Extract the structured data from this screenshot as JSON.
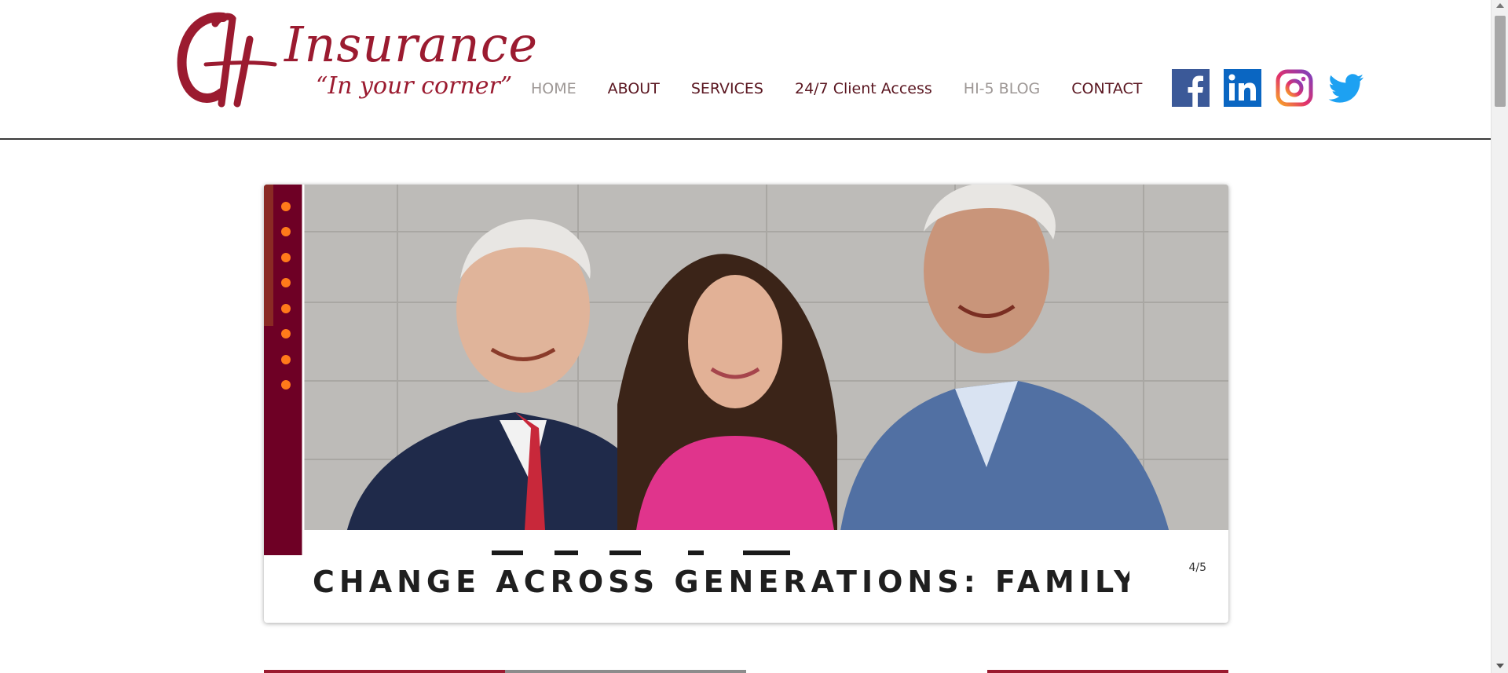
{
  "brand": {
    "monogram": "CH",
    "name": "Insurance",
    "tagline": "“In your corner”",
    "color": "#9b1b30"
  },
  "nav": {
    "items": [
      {
        "label": "HOME",
        "muted": true
      },
      {
        "label": "ABOUT",
        "muted": false
      },
      {
        "label": "SERVICES",
        "muted": false
      },
      {
        "label": "24/7 Client Access",
        "muted": false
      },
      {
        "label": "HI-5 BLOG",
        "muted": true
      },
      {
        "label": "CONTACT",
        "muted": false
      }
    ]
  },
  "social": [
    "facebook-icon",
    "linkedin-icon",
    "instagram-icon",
    "twitter-icon"
  ],
  "slideshow": {
    "caption": "CHANGE ACROSS GENERATIONS: FAMILY-O…",
    "counter": "4/5"
  },
  "colors": {
    "nav_text": "#5a1620",
    "nav_muted": "#9d9795",
    "maroon": "#6e0025",
    "dot_orange": "#ff7a1a",
    "facebook": "#3b5998",
    "linkedin": "#0a66c2",
    "twitter": "#1da1f2"
  }
}
